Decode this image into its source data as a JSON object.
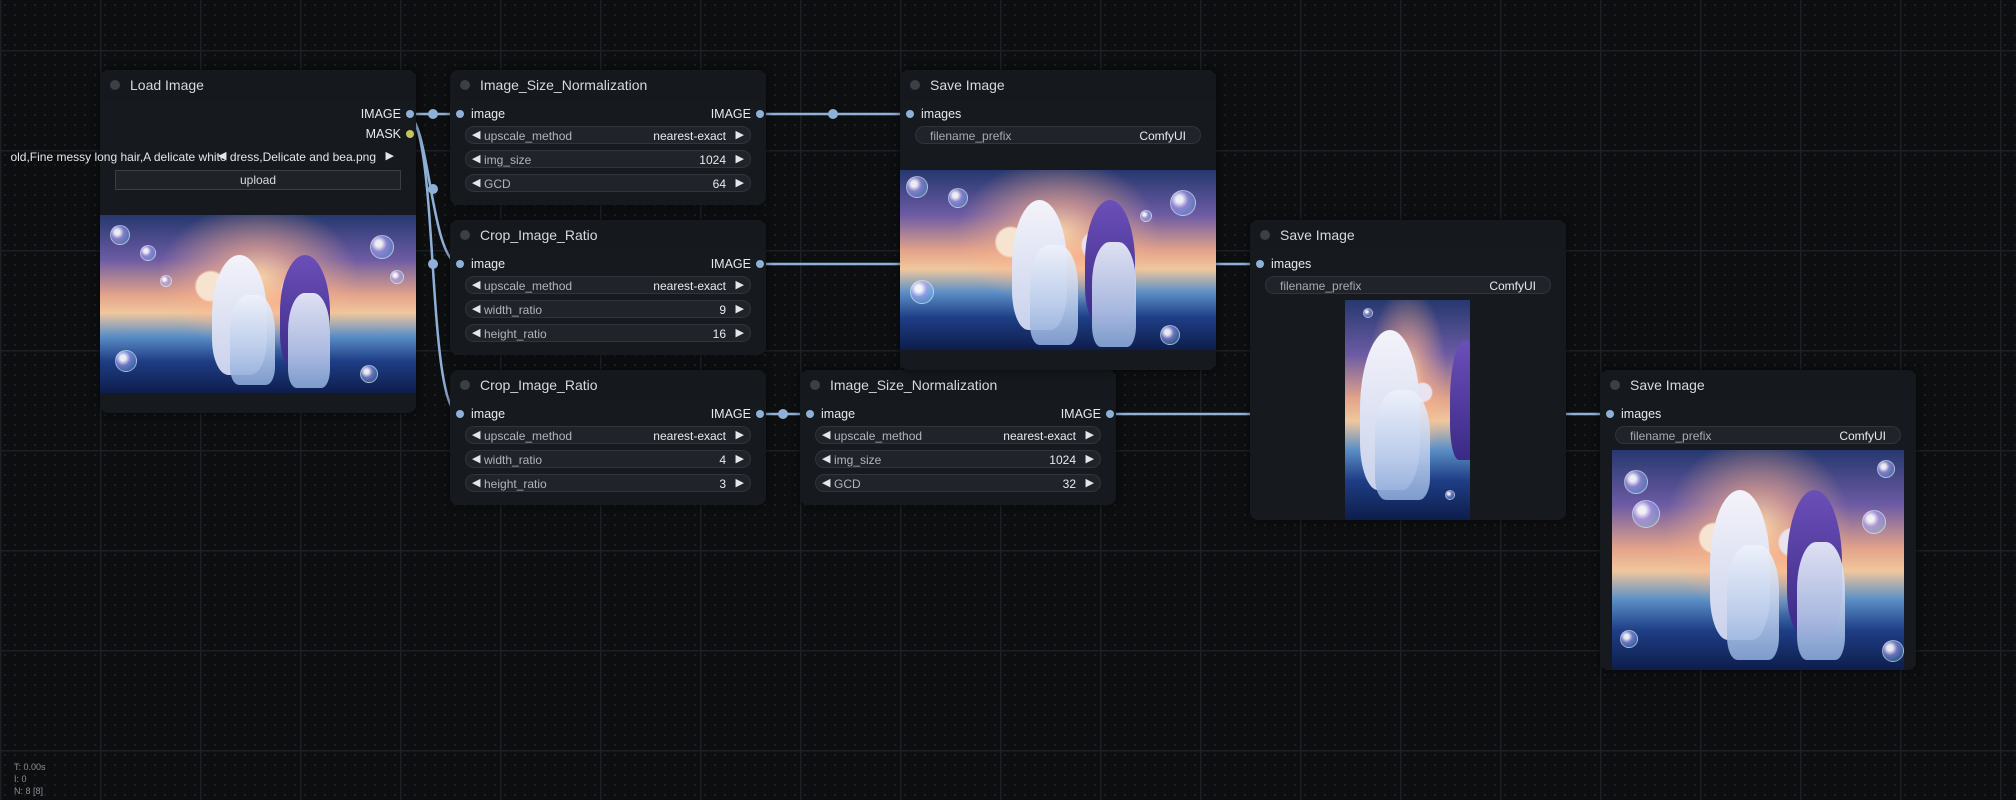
{
  "nodes": {
    "load_image": {
      "title": "Load Image",
      "outputs": [
        "IMAGE",
        "MASK"
      ],
      "image_value": "old,Fine messy long hair,A delicate white dress,Delicate and bea.png",
      "image_prefix": "",
      "upload_label": "upload"
    },
    "size_norm_1": {
      "title": "Image_Size_Normalization",
      "input": "image",
      "output": "IMAGE",
      "widgets": [
        {
          "label": "upscale_method",
          "value": "nearest-exact"
        },
        {
          "label": "img_size",
          "value": "1024"
        },
        {
          "label": "GCD",
          "value": "64"
        }
      ]
    },
    "crop_ratio_1": {
      "title": "Crop_Image_Ratio",
      "input": "image",
      "output": "IMAGE",
      "widgets": [
        {
          "label": "upscale_method",
          "value": "nearest-exact"
        },
        {
          "label": "width_ratio",
          "value": "9"
        },
        {
          "label": "height_ratio",
          "value": "16"
        }
      ]
    },
    "crop_ratio_2": {
      "title": "Crop_Image_Ratio",
      "input": "image",
      "output": "IMAGE",
      "widgets": [
        {
          "label": "upscale_method",
          "value": "nearest-exact"
        },
        {
          "label": "width_ratio",
          "value": "4"
        },
        {
          "label": "height_ratio",
          "value": "3"
        }
      ]
    },
    "size_norm_2": {
      "title": "Image_Size_Normalization",
      "input": "image",
      "output": "IMAGE",
      "widgets": [
        {
          "label": "upscale_method",
          "value": "nearest-exact"
        },
        {
          "label": "img_size",
          "value": "1024"
        },
        {
          "label": "GCD",
          "value": "32"
        }
      ]
    },
    "save_image_1": {
      "title": "Save Image",
      "input": "images",
      "widget": {
        "label": "filename_prefix",
        "value": "ComfyUI"
      }
    },
    "save_image_2": {
      "title": "Save Image",
      "input": "images",
      "widget": {
        "label": "filename_prefix",
        "value": "ComfyUI"
      }
    },
    "save_image_3": {
      "title": "Save Image",
      "input": "images",
      "widget": {
        "label": "filename_prefix",
        "value": "ComfyUI"
      }
    }
  },
  "stats": {
    "time": "T: 0.00s",
    "iterations": "I: 0",
    "nodes": "N: 8 [8]"
  },
  "colors": {
    "link": "#8fb1d8",
    "mask_slot": "#c7c35e",
    "canvas": "#0d0e10",
    "node_bg": "#16191e"
  },
  "icons": {
    "left_arrow": "◀",
    "right_arrow": "▶"
  }
}
